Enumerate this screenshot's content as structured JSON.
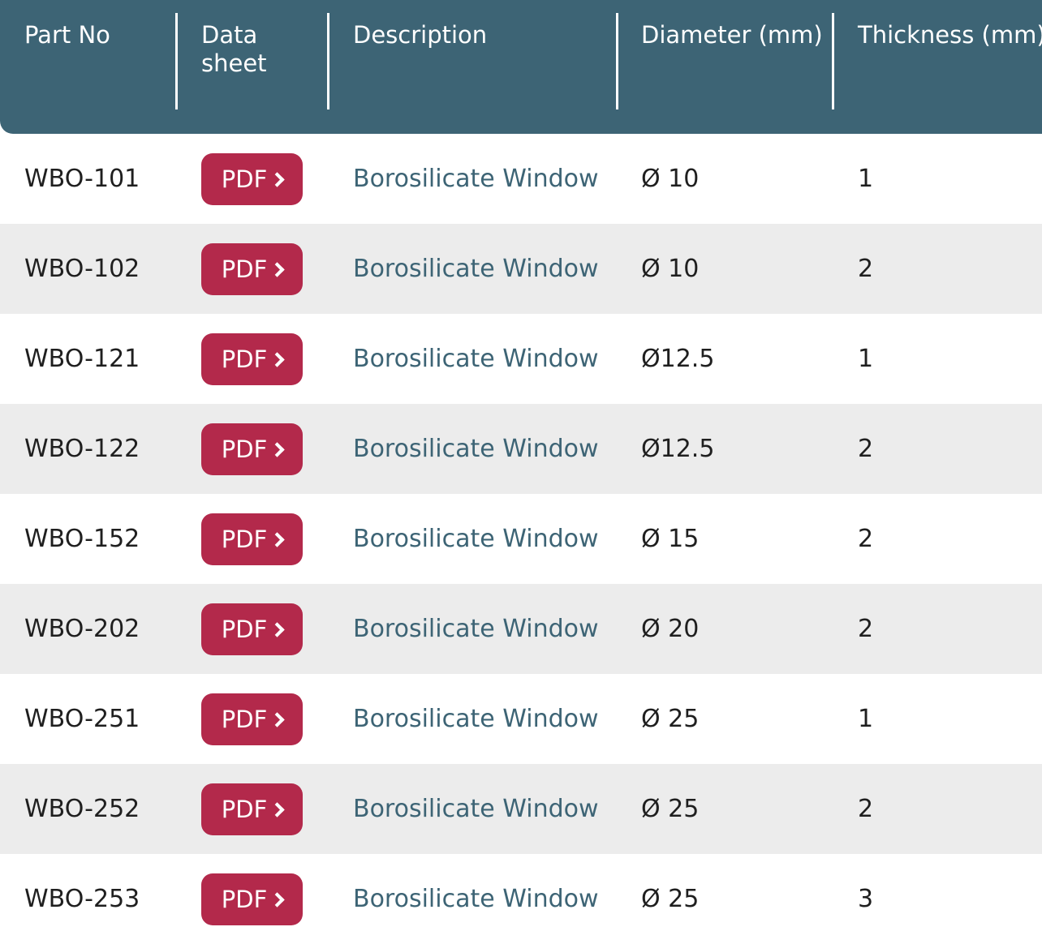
{
  "colors": {
    "header_bg": "#3d6475",
    "pdf_button": "#b3294b",
    "row_alt_bg": "#ececec",
    "description_text": "#3d6475"
  },
  "header": {
    "part_no": "Part No",
    "data_sheet": "Data sheet",
    "description": "Description",
    "diameter": "Diameter (mm)",
    "thickness": "Thickness (mm)"
  },
  "rows": [
    {
      "part_no": "WBO-101",
      "pdf_label": "PDF",
      "description": "Borosilicate Window",
      "diameter": "Ø 10",
      "thickness": "1"
    },
    {
      "part_no": "WBO-102",
      "pdf_label": "PDF",
      "description": "Borosilicate Window",
      "diameter": "Ø 10",
      "thickness": "2"
    },
    {
      "part_no": "WBO-121",
      "pdf_label": "PDF",
      "description": "Borosilicate Window",
      "diameter": "Ø12.5",
      "thickness": "1"
    },
    {
      "part_no": "WBO-122",
      "pdf_label": "PDF",
      "description": "Borosilicate Window",
      "diameter": "Ø12.5",
      "thickness": "2"
    },
    {
      "part_no": "WBO-152",
      "pdf_label": "PDF",
      "description": "Borosilicate Window",
      "diameter": "Ø 15",
      "thickness": "2"
    },
    {
      "part_no": "WBO-202",
      "pdf_label": "PDF",
      "description": "Borosilicate Window",
      "diameter": "Ø 20",
      "thickness": "2"
    },
    {
      "part_no": "WBO-251",
      "pdf_label": "PDF",
      "description": "Borosilicate Window",
      "diameter": "Ø 25",
      "thickness": "1"
    },
    {
      "part_no": "WBO-252",
      "pdf_label": "PDF",
      "description": "Borosilicate Window",
      "diameter": "Ø 25",
      "thickness": "2"
    },
    {
      "part_no": "WBO-253",
      "pdf_label": "PDF",
      "description": "Borosilicate Window",
      "diameter": "Ø 25",
      "thickness": "3"
    }
  ]
}
